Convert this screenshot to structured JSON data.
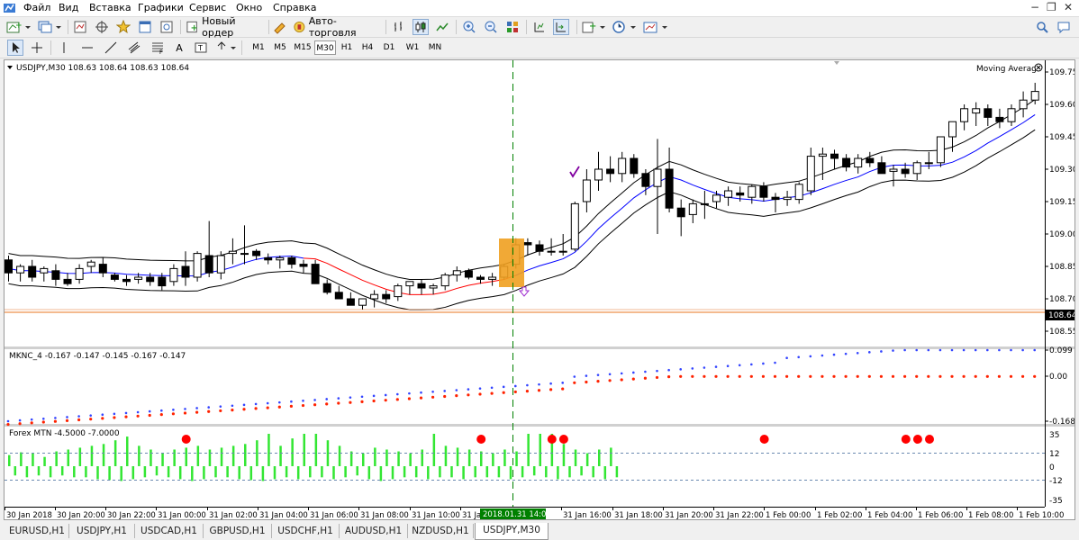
{
  "menu": {
    "items": [
      "Файл",
      "Вид",
      "Вставка",
      "Графики",
      "Сервис",
      "Окно",
      "Справка"
    ]
  },
  "toolbar": {
    "new_order_label": "Новый ордер",
    "autotrading_label": "Авто-торговля"
  },
  "timeframes": [
    "M1",
    "M5",
    "M15",
    "M30",
    "H1",
    "H4",
    "D1",
    "W1",
    "MN"
  ],
  "active_timeframe": "M30",
  "chart": {
    "header": "USDJPY,M30  108.63 108.64 108.63 108.64",
    "indicator_name": "Moving Average",
    "current_price_label": "108.64",
    "price_ticks": [
      "109.75",
      "109.60",
      "109.45",
      "109.30",
      "109.15",
      "109.00",
      "108.85",
      "108.70",
      "108.55"
    ],
    "time_ticks": [
      "30 Jan 2018",
      "30 Jan 20:00",
      "30 Jan 22:00",
      "31 Jan 00:00",
      "31 Jan 02:00",
      "31 Jan 04:00",
      "31 Jan 06:00",
      "31 Jan 08:00",
      "31 Jan 10:00",
      "31 Jan 12",
      "31 Jan 16:00",
      "31 Jan 18:00",
      "31 Jan 20:00",
      "31 Jan 22:00",
      "1 Feb 00:00",
      "1 Feb 02:00",
      "1 Feb 04:00",
      "1 Feb 06:00",
      "1 Feb 08:00",
      "1 Feb 10:00"
    ],
    "cursor_time_label": "2018.01.31 14:00"
  },
  "mknc": {
    "header": "MKNC_4 -0.167 -0.147 -0.145 -0.167 -0.147",
    "ticks": [
      "0.099",
      "0.00",
      "-0.168"
    ]
  },
  "mtn": {
    "header": "Forex MTN -4.5000 -7.0000",
    "ticks": [
      "35",
      "12",
      "0",
      "-12",
      "-35"
    ]
  },
  "tabs": [
    "EURUSD,H1",
    "USDJPY,H1",
    "USDCAD,H1",
    "GBPUSD,H1",
    "USDCHF,H1",
    "AUDUSD,H1",
    "NZDUSD,H1",
    "USDJPY,M30"
  ],
  "active_tab": "USDJPY,M30",
  "colors": {
    "bull_body": "#ffffff",
    "bear_body": "#000000",
    "ma_blue": "#0000ff",
    "ma_red": "#ff0000",
    "price_line": "#e8761f",
    "highlight": "#f0a020",
    "cursor_line": "#008000",
    "check_mark": "#8000a0",
    "mtn_bar": "#33e633",
    "mtn_dot": "#ff0000",
    "dots_blue": "#3344ff",
    "dots_red": "#ff2200"
  },
  "candles": [
    {
      "o": 108.88,
      "h": 108.9,
      "l": 108.78,
      "c": 108.82
    },
    {
      "o": 108.82,
      "h": 108.86,
      "l": 108.78,
      "c": 108.85
    },
    {
      "o": 108.85,
      "h": 108.88,
      "l": 108.78,
      "c": 108.8
    },
    {
      "o": 108.82,
      "h": 108.85,
      "l": 108.78,
      "c": 108.84
    },
    {
      "o": 108.83,
      "h": 108.86,
      "l": 108.76,
      "c": 108.79
    },
    {
      "o": 108.79,
      "h": 108.82,
      "l": 108.76,
      "c": 108.77
    },
    {
      "o": 108.79,
      "h": 108.86,
      "l": 108.77,
      "c": 108.84
    },
    {
      "o": 108.85,
      "h": 108.88,
      "l": 108.82,
      "c": 108.87
    },
    {
      "o": 108.86,
      "h": 108.89,
      "l": 108.8,
      "c": 108.82
    },
    {
      "o": 108.81,
      "h": 108.82,
      "l": 108.78,
      "c": 108.79
    },
    {
      "o": 108.79,
      "h": 108.81,
      "l": 108.76,
      "c": 108.78
    },
    {
      "o": 108.79,
      "h": 108.82,
      "l": 108.77,
      "c": 108.8
    },
    {
      "o": 108.8,
      "h": 108.82,
      "l": 108.76,
      "c": 108.78
    },
    {
      "o": 108.8,
      "h": 108.82,
      "l": 108.74,
      "c": 108.76
    },
    {
      "o": 108.78,
      "h": 108.86,
      "l": 108.76,
      "c": 108.84
    },
    {
      "o": 108.85,
      "h": 108.92,
      "l": 108.76,
      "c": 108.8
    },
    {
      "o": 108.8,
      "h": 108.92,
      "l": 108.78,
      "c": 108.91
    },
    {
      "o": 108.9,
      "h": 109.06,
      "l": 108.8,
      "c": 108.82
    },
    {
      "o": 108.82,
      "h": 108.92,
      "l": 108.79,
      "c": 108.9
    },
    {
      "o": 108.91,
      "h": 108.98,
      "l": 108.86,
      "c": 108.92
    },
    {
      "o": 108.91,
      "h": 109.04,
      "l": 108.86,
      "c": 108.91
    },
    {
      "o": 108.92,
      "h": 108.93,
      "l": 108.88,
      "c": 108.9
    },
    {
      "o": 108.89,
      "h": 108.91,
      "l": 108.86,
      "c": 108.88
    },
    {
      "o": 108.88,
      "h": 108.9,
      "l": 108.84,
      "c": 108.89
    },
    {
      "o": 108.89,
      "h": 108.9,
      "l": 108.84,
      "c": 108.86
    },
    {
      "o": 108.86,
      "h": 108.88,
      "l": 108.82,
      "c": 108.85
    },
    {
      "o": 108.86,
      "h": 108.88,
      "l": 108.78,
      "c": 108.77
    },
    {
      "o": 108.77,
      "h": 108.79,
      "l": 108.72,
      "c": 108.73
    },
    {
      "o": 108.73,
      "h": 108.76,
      "l": 108.71,
      "c": 108.7
    },
    {
      "o": 108.7,
      "h": 108.73,
      "l": 108.67,
      "c": 108.67
    },
    {
      "o": 108.67,
      "h": 108.7,
      "l": 108.65,
      "c": 108.7
    },
    {
      "o": 108.7,
      "h": 108.74,
      "l": 108.66,
      "c": 108.72
    },
    {
      "o": 108.72,
      "h": 108.74,
      "l": 108.68,
      "c": 108.7
    },
    {
      "o": 108.71,
      "h": 108.77,
      "l": 108.69,
      "c": 108.76
    },
    {
      "o": 108.76,
      "h": 108.78,
      "l": 108.72,
      "c": 108.78
    },
    {
      "o": 108.77,
      "h": 108.79,
      "l": 108.72,
      "c": 108.75
    },
    {
      "o": 108.75,
      "h": 108.77,
      "l": 108.72,
      "c": 108.76
    },
    {
      "o": 108.76,
      "h": 108.82,
      "l": 108.74,
      "c": 108.81
    },
    {
      "o": 108.81,
      "h": 108.85,
      "l": 108.78,
      "c": 108.83
    },
    {
      "o": 108.83,
      "h": 108.84,
      "l": 108.79,
      "c": 108.8
    },
    {
      "o": 108.8,
      "h": 108.81,
      "l": 108.77,
      "c": 108.79
    },
    {
      "o": 108.79,
      "h": 108.82,
      "l": 108.76,
      "c": 108.8
    },
    {
      "o": 108.8,
      "h": 108.86,
      "l": 108.79,
      "c": 108.85
    },
    {
      "o": 108.86,
      "h": 108.98,
      "l": 108.84,
      "c": 108.95
    },
    {
      "o": 108.96,
      "h": 108.98,
      "l": 108.9,
      "c": 108.95
    },
    {
      "o": 108.95,
      "h": 108.97,
      "l": 108.9,
      "c": 108.92
    },
    {
      "o": 108.92,
      "h": 108.98,
      "l": 108.9,
      "c": 108.92
    },
    {
      "o": 108.92,
      "h": 109.0,
      "l": 108.9,
      "c": 108.92
    },
    {
      "o": 108.93,
      "h": 109.15,
      "l": 108.92,
      "c": 109.14
    },
    {
      "o": 109.15,
      "h": 109.3,
      "l": 109.1,
      "c": 109.25
    },
    {
      "o": 109.25,
      "h": 109.38,
      "l": 109.2,
      "c": 109.3
    },
    {
      "o": 109.3,
      "h": 109.36,
      "l": 109.24,
      "c": 109.28
    },
    {
      "o": 109.28,
      "h": 109.38,
      "l": 109.24,
      "c": 109.35
    },
    {
      "o": 109.35,
      "h": 109.37,
      "l": 109.26,
      "c": 109.28
    },
    {
      "o": 109.28,
      "h": 109.3,
      "l": 109.18,
      "c": 109.22
    },
    {
      "o": 109.22,
      "h": 109.44,
      "l": 109.0,
      "c": 109.3
    },
    {
      "o": 109.3,
      "h": 109.4,
      "l": 109.1,
      "c": 109.12
    },
    {
      "o": 109.12,
      "h": 109.16,
      "l": 108.99,
      "c": 109.08
    },
    {
      "o": 109.09,
      "h": 109.16,
      "l": 109.05,
      "c": 109.14
    },
    {
      "o": 109.14,
      "h": 109.2,
      "l": 109.07,
      "c": 109.14
    },
    {
      "o": 109.15,
      "h": 109.2,
      "l": 109.12,
      "c": 109.18
    },
    {
      "o": 109.17,
      "h": 109.22,
      "l": 109.13,
      "c": 109.2
    },
    {
      "o": 109.19,
      "h": 109.22,
      "l": 109.15,
      "c": 109.18
    },
    {
      "o": 109.17,
      "h": 109.23,
      "l": 109.14,
      "c": 109.22
    },
    {
      "o": 109.22,
      "h": 109.24,
      "l": 109.15,
      "c": 109.17
    },
    {
      "o": 109.17,
      "h": 109.19,
      "l": 109.1,
      "c": 109.16
    },
    {
      "o": 109.16,
      "h": 109.2,
      "l": 109.13,
      "c": 109.17
    },
    {
      "o": 109.16,
      "h": 109.24,
      "l": 109.14,
      "c": 109.23
    },
    {
      "o": 109.2,
      "h": 109.4,
      "l": 109.18,
      "c": 109.36
    },
    {
      "o": 109.36,
      "h": 109.4,
      "l": 109.25,
      "c": 109.37
    },
    {
      "o": 109.37,
      "h": 109.39,
      "l": 109.3,
      "c": 109.35
    },
    {
      "o": 109.35,
      "h": 109.37,
      "l": 109.29,
      "c": 109.31
    },
    {
      "o": 109.31,
      "h": 109.37,
      "l": 109.28,
      "c": 109.35
    },
    {
      "o": 109.35,
      "h": 109.38,
      "l": 109.31,
      "c": 109.33
    },
    {
      "o": 109.33,
      "h": 109.36,
      "l": 109.28,
      "c": 109.28
    },
    {
      "o": 109.29,
      "h": 109.32,
      "l": 109.22,
      "c": 109.3
    },
    {
      "o": 109.3,
      "h": 109.33,
      "l": 109.26,
      "c": 109.28
    },
    {
      "o": 109.28,
      "h": 109.34,
      "l": 109.25,
      "c": 109.33
    },
    {
      "o": 109.33,
      "h": 109.38,
      "l": 109.3,
      "c": 109.33
    },
    {
      "o": 109.33,
      "h": 109.4,
      "l": 109.31,
      "c": 109.45
    },
    {
      "o": 109.45,
      "h": 109.5,
      "l": 109.38,
      "c": 109.52
    },
    {
      "o": 109.52,
      "h": 109.6,
      "l": 109.48,
      "c": 109.58
    },
    {
      "o": 109.56,
      "h": 109.61,
      "l": 109.5,
      "c": 109.58
    },
    {
      "o": 109.58,
      "h": 109.6,
      "l": 109.5,
      "c": 109.54
    },
    {
      "o": 109.54,
      "h": 109.58,
      "l": 109.49,
      "c": 109.52
    },
    {
      "o": 109.52,
      "h": 109.6,
      "l": 109.5,
      "c": 109.58
    },
    {
      "o": 109.58,
      "h": 109.66,
      "l": 109.54,
      "c": 109.62
    },
    {
      "o": 109.62,
      "h": 109.7,
      "l": 109.6,
      "c": 109.66
    }
  ],
  "mtn_values": [
    12,
    -10,
    15,
    -12,
    14,
    -10,
    10,
    -12,
    16,
    -10,
    18,
    -12,
    20,
    -12,
    22,
    -14,
    24,
    -15,
    28,
    -16,
    32,
    -14,
    22,
    -12,
    18,
    -10,
    14,
    -12,
    18,
    -14,
    20,
    -16,
    22,
    -14,
    18,
    -12,
    20,
    -12,
    22,
    -14,
    24,
    -15,
    28,
    -16,
    35,
    -14,
    22,
    -12,
    30,
    -14,
    35,
    -12,
    35,
    -12,
    28,
    -14,
    22,
    -12,
    16,
    -10,
    14,
    -14,
    20,
    -16,
    18,
    -14,
    16,
    -12,
    14,
    -12,
    18,
    -14,
    35,
    -12,
    22,
    -12,
    20,
    -14,
    18,
    -12,
    16,
    -12,
    14,
    -12,
    18,
    -14,
    16,
    -12,
    35,
    -10,
    35,
    -12,
    35,
    -14,
    24,
    -12,
    18,
    -10,
    14,
    -12,
    18,
    -14,
    20,
    -12
  ],
  "mtn_dot_indices": [
    15,
    40,
    46,
    47,
    64,
    76,
    77,
    78
  ]
}
